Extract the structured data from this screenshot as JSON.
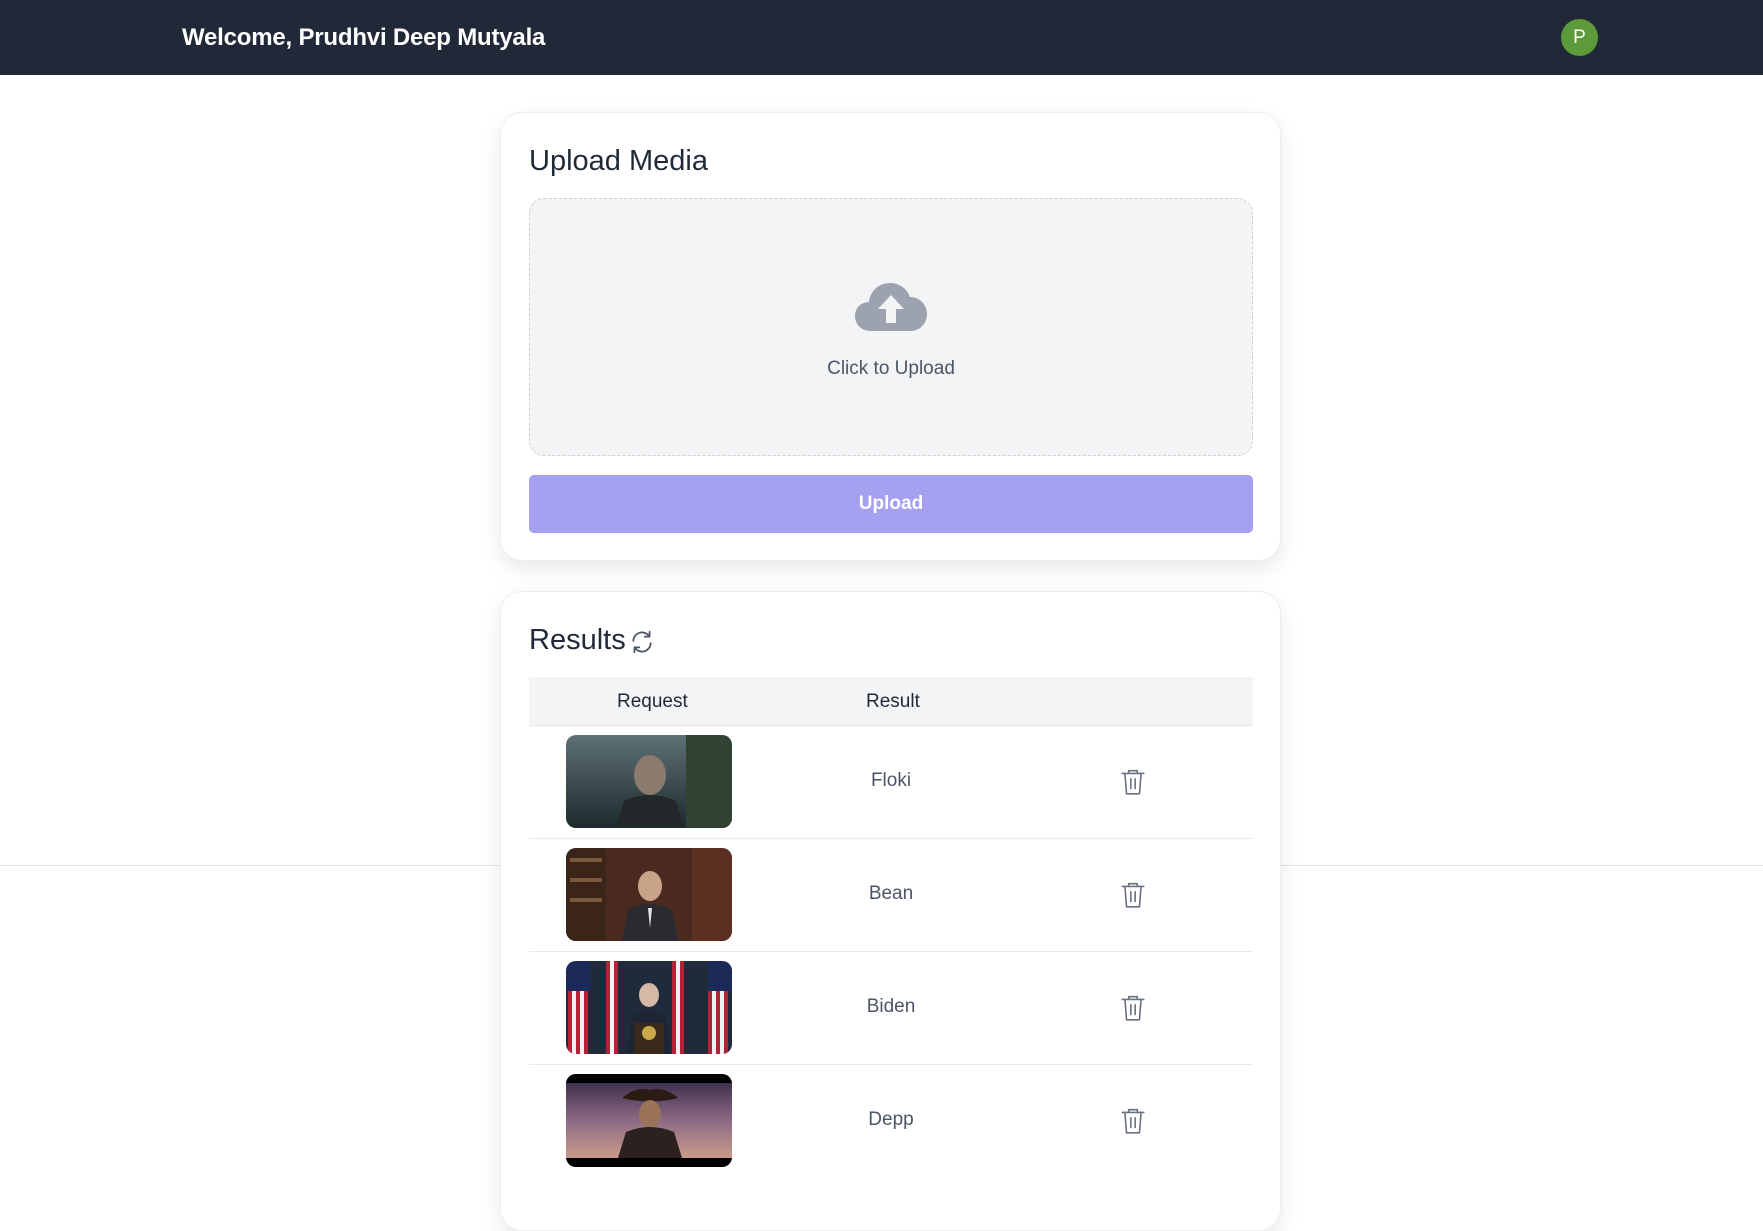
{
  "header": {
    "welcome_text": "Welcome, Prudhvi Deep Mutyala",
    "avatar_initial": "P",
    "background_color": "#212938",
    "avatar_color": "#5c9a3a"
  },
  "upload": {
    "title": "Upload Media",
    "dropzone_label": "Click to Upload",
    "dropzone_icon": "cloud-upload-icon",
    "button_label": "Upload",
    "button_color": "#a5a0ef"
  },
  "results": {
    "title": "Results",
    "refresh_icon": "refresh-icon",
    "columns": [
      "Request",
      "Result"
    ],
    "rows": [
      {
        "thumbnail": "video-thumbnail",
        "result": "Floki",
        "delete_icon": "trash-icon"
      },
      {
        "thumbnail": "video-thumbnail",
        "result": "Bean",
        "delete_icon": "trash-icon"
      },
      {
        "thumbnail": "video-thumbnail",
        "result": "Biden",
        "delete_icon": "trash-icon"
      },
      {
        "thumbnail": "video-thumbnail",
        "result": "Depp",
        "delete_icon": "trash-icon"
      }
    ]
  }
}
